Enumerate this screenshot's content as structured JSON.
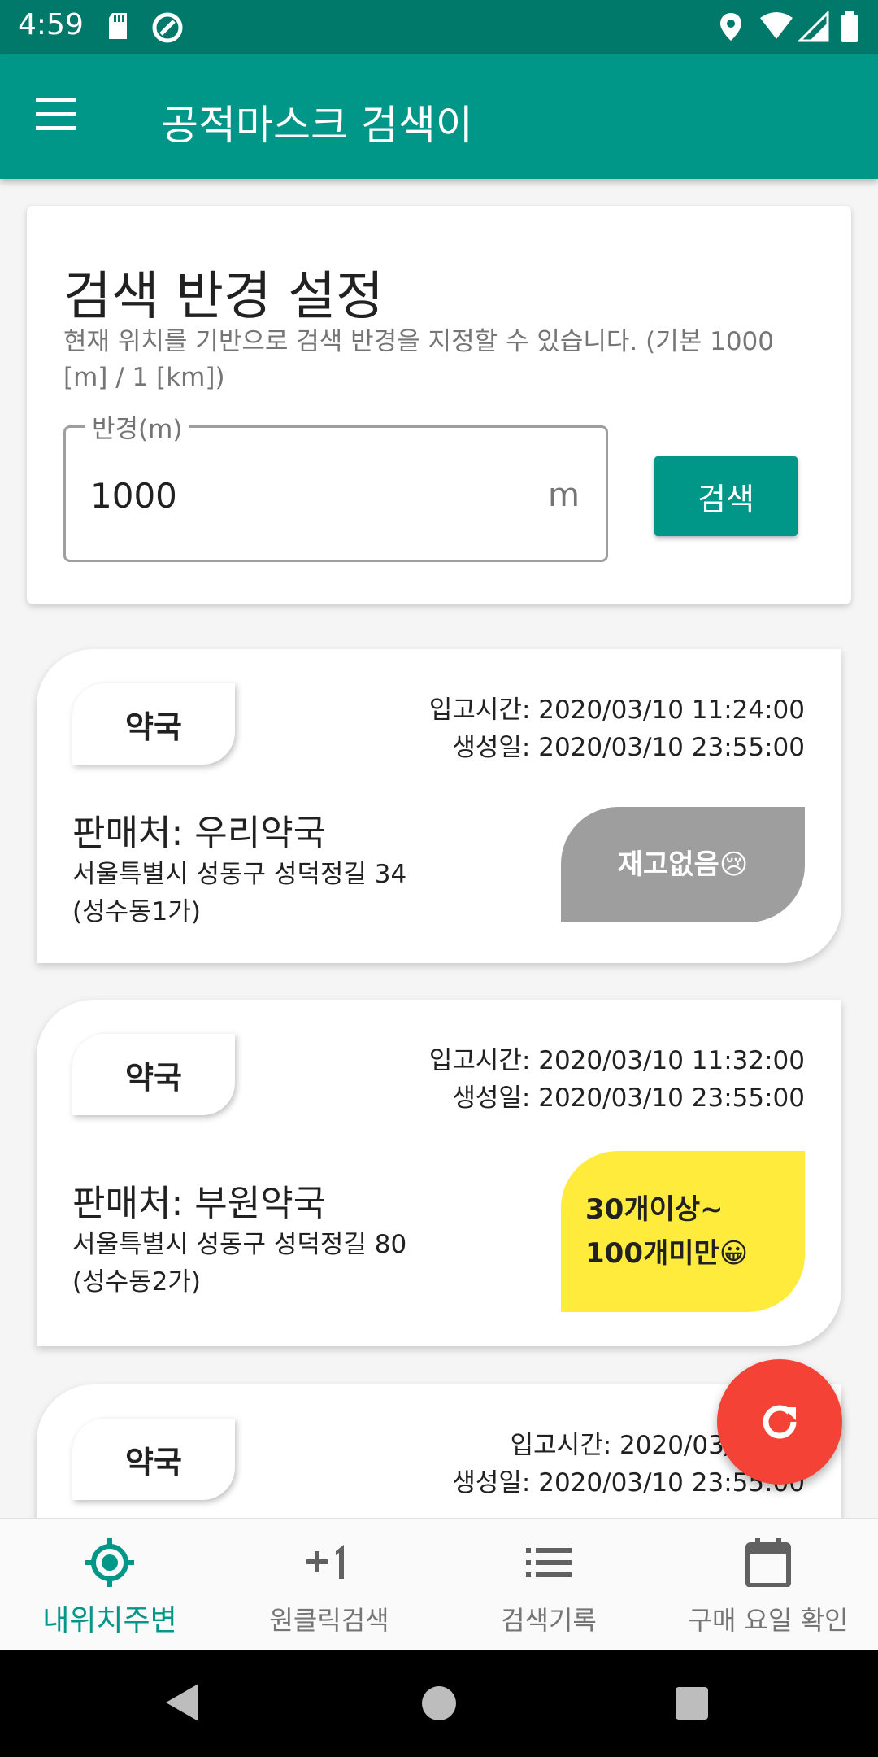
{
  "status_bar": {
    "time": "4:59",
    "icons": [
      "sd-card-icon",
      "sync-icon",
      "location-icon",
      "wifi-icon",
      "signal-icon",
      "battery-icon"
    ]
  },
  "app_bar": {
    "title": "공적마스크 검색이",
    "menu_icon": "hamburger-menu-icon"
  },
  "search_card": {
    "title": "검색 반경 설정",
    "description": "현재 위치를 기반으로 검색 반경을 지정할 수 있습니다. (기본 1000 [m] / 1 [km])",
    "field_label": "반경(m)",
    "field_value": "1000",
    "field_unit": "m",
    "button_label": "검색"
  },
  "stores": [
    {
      "type": "약국",
      "stock_time": "입고시간: 2020/03/10 11:24:00",
      "created_at": "생성일: 2020/03/10 23:55:00",
      "seller": "판매처: 우리약국",
      "address": "서울특별시 성동구 성덕정길 34 (성수동1가)",
      "stock_label": "재고없음😢",
      "stock_color": "#9e9e9e"
    },
    {
      "type": "약국",
      "stock_time": "입고시간: 2020/03/10 11:32:00",
      "created_at": "생성일: 2020/03/10 23:55:00",
      "seller": "판매처: 부원약국",
      "address": "서울특별시 성동구 성덕정길 80 (성수동2가)",
      "stock_label": "30개이상~ 100개미만😀",
      "stock_color": "#ffeb3b"
    },
    {
      "type": "약국",
      "stock_time": "입고시간: 2020/03/10 09",
      "created_at": "생성일: 2020/03/10 23:55:00"
    }
  ],
  "fab": {
    "icon": "refresh-icon",
    "color": "#f44336"
  },
  "bottom_nav": [
    {
      "label": "내위치주변",
      "icon": "my-location-icon",
      "active": true
    },
    {
      "label": "원클릭검색",
      "icon": "plus-one-icon",
      "active": false
    },
    {
      "label": "검색기록",
      "icon": "list-icon",
      "active": false
    },
    {
      "label": "구매 요일 확인",
      "icon": "calendar-icon",
      "active": false
    }
  ],
  "colors": {
    "primary": "#009688",
    "primary_dark": "#00796b",
    "accent": "#f44336"
  }
}
